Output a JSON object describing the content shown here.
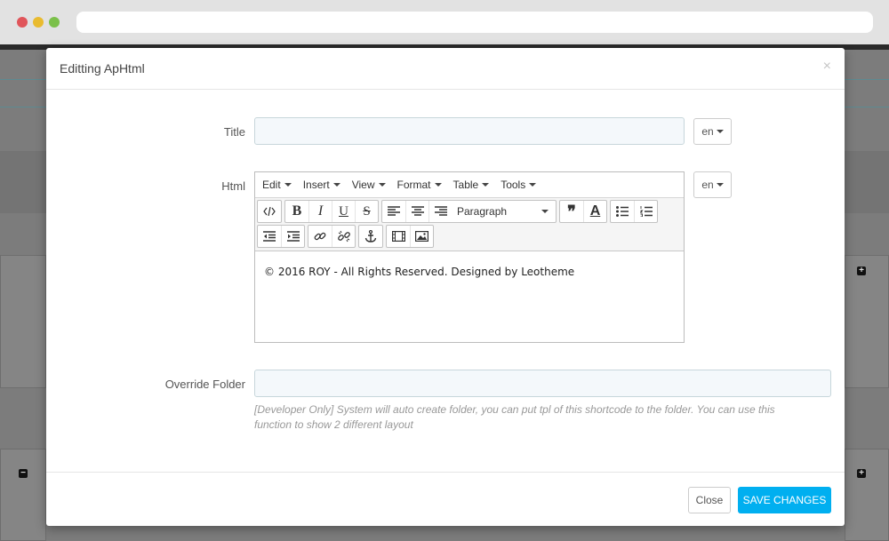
{
  "modal": {
    "title": "Editting ApHtml",
    "close_glyph": "×"
  },
  "form": {
    "title_label": "Title",
    "title_value": "",
    "title_lang": "en",
    "html_label": "Html",
    "html_lang": "en",
    "override_label": "Override Folder",
    "override_value": "",
    "override_help": "[Developer Only] System will auto create folder, you can put tpl of this shortcode to the folder. You can use this function to show 2 different layout"
  },
  "editor": {
    "menus": [
      {
        "label": "Edit"
      },
      {
        "label": "Insert"
      },
      {
        "label": "View"
      },
      {
        "label": "Format"
      },
      {
        "label": "Table"
      },
      {
        "label": "Tools"
      }
    ],
    "toolbar": {
      "source_code_icon": "code-icon",
      "bold_glyph": "B",
      "italic_glyph": "I",
      "underline_glyph": "U",
      "strikethrough_glyph": "S",
      "align_left_icon": "align-left-icon",
      "align_center_icon": "align-center-icon",
      "align_right_icon": "align-right-icon",
      "block_format": "Paragraph",
      "blockquote_icon": "blockquote-icon",
      "text_color_glyph": "A",
      "bullet_list_icon": "bullet-list-icon",
      "numbered_list_icon": "numbered-list-icon",
      "outdent_icon": "outdent-icon",
      "indent_icon": "indent-icon",
      "link_icon": "link-icon",
      "unlink_icon": "unlink-icon",
      "anchor_icon": "anchor-icon",
      "media_icon": "film-icon",
      "image_icon": "image-icon"
    },
    "content": "© 2016 ROY - All Rights Reserved. Designed by Leotheme"
  },
  "footer": {
    "close_label": "Close",
    "save_label": "SAVE CHANGES"
  },
  "colors": {
    "primary": "#00aff0",
    "input_bg": "#f4f8fb"
  }
}
